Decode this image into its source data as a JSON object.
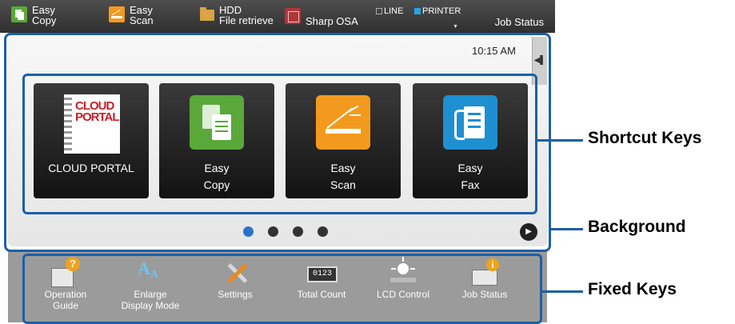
{
  "topbar": {
    "easy_copy": [
      "Easy",
      "Copy"
    ],
    "easy_scan": [
      "Easy",
      "Scan"
    ],
    "hdd": [
      "HDD",
      "File retrieve"
    ],
    "sharp_osa": "Sharp OSA",
    "line": "LINE",
    "printer": "PRINTER",
    "job_status": "Job Status"
  },
  "screen": {
    "time": "10:15 AM",
    "tiles": [
      {
        "line1": "CLOUD PORTAL",
        "line2": "",
        "logo_line1": "CLOUD",
        "logo_line2": "PORTAL",
        "color": "#c8202a"
      },
      {
        "line1": "Easy",
        "line2": "Copy",
        "color": "#5aa83a"
      },
      {
        "line1": "Easy",
        "line2": "Scan",
        "color": "#f39a1e"
      },
      {
        "line1": "Easy",
        "line2": "Fax",
        "color": "#1e8fd0"
      }
    ],
    "page_dots": 4,
    "active_dot": 1
  },
  "fixed_keys": [
    {
      "line1": "Operation",
      "line2": "Guide",
      "icon": "operation-guide-icon"
    },
    {
      "line1": "Enlarge",
      "line2": "Display Mode",
      "icon": "enlarge-display-icon"
    },
    {
      "line1": "Settings",
      "line2": "",
      "icon": "settings-icon"
    },
    {
      "line1": "Total Count",
      "line2": "",
      "icon": "total-count-icon"
    },
    {
      "line1": "LCD Control",
      "line2": "",
      "icon": "lcd-control-icon"
    },
    {
      "line1": "Job Status",
      "line2": "",
      "icon": "job-status-icon"
    }
  ],
  "callouts": {
    "shortcut": "Shortcut Keys",
    "background": "Background",
    "fixed": "Fixed Keys"
  },
  "colors": {
    "callout_blue": "#1d5fa7",
    "active_dot": "#2a74c8",
    "copy_green": "#5aa83a",
    "scan_orange": "#f39a1e",
    "fax_blue": "#1e8fd0",
    "cloud_red": "#c8202a"
  }
}
